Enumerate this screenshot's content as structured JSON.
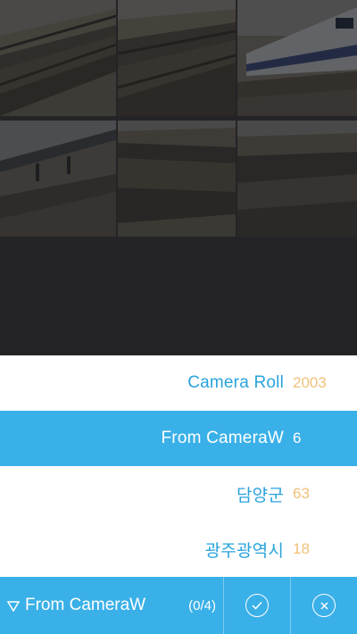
{
  "albums": [
    {
      "name": "Camera Roll",
      "count": "2003",
      "selected": false
    },
    {
      "name": "From CameraW",
      "count": "6",
      "selected": true
    },
    {
      "name": "담양군",
      "count": "63",
      "selected": false
    },
    {
      "name": "광주광역시",
      "count": "18",
      "selected": false
    }
  ],
  "bottom_bar": {
    "current_album": "From CameraW",
    "selection_count": "(0/4)",
    "confirm_icon": "check-circle-icon",
    "cancel_icon": "close-circle-icon"
  },
  "photos": [
    {
      "subject": "railway tracks"
    },
    {
      "subject": "railway tracks"
    },
    {
      "subject": "train"
    },
    {
      "subject": "station platform"
    },
    {
      "subject": "railway tracks"
    },
    {
      "subject": "railway tracks"
    }
  ],
  "colors": {
    "accent": "#3ab0e8",
    "album_name": "#29a3dc",
    "album_count": "#f0c179",
    "overlay": "#3d3d3f"
  }
}
